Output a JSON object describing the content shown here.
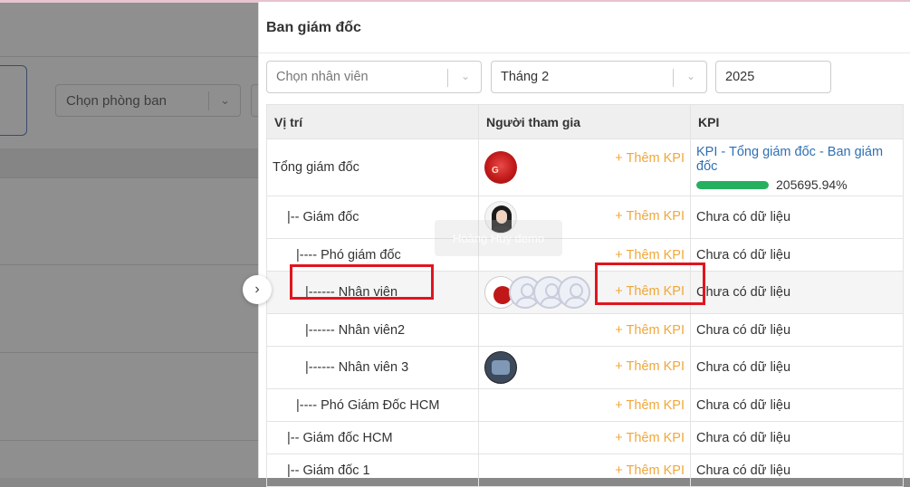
{
  "background": {
    "department_select_placeholder": "Chọn phòng ban"
  },
  "drawer": {
    "title": "Ban giám đốc",
    "filters": {
      "employee_placeholder": "Chọn nhân viên",
      "month_value": "Tháng 2",
      "year_value": "2025"
    },
    "table": {
      "headers": [
        "Vị trí",
        "Người tham gia",
        "KPI"
      ],
      "add_kpi_label": "+ Thêm KPI",
      "no_data_label": "Chưa có dữ liệu",
      "rows": [
        {
          "position": "Tổng giám đốc",
          "indent": 0,
          "avatars": [
            "red-avatar"
          ],
          "kpi_link": "KPI - Tổng giám đốc - Ban giám đốc",
          "progress": 1.0,
          "progress_text": "205695.94%"
        },
        {
          "position": "|-- Giám đốc",
          "indent": 1,
          "avatars": [
            "woman-avatar"
          ]
        },
        {
          "position": "|---- Phó giám đốc",
          "indent": 2,
          "avatars": []
        },
        {
          "position": "|------ Nhân viên",
          "indent": 3,
          "avatars": [
            "flower-avatar",
            "placeholder-avatar",
            "placeholder-avatar",
            "placeholder-avatar"
          ]
        },
        {
          "position": "|------ Nhân viên2",
          "indent": 3,
          "avatars": []
        },
        {
          "position": "|------ Nhân viên 3",
          "indent": 3,
          "avatars": [
            "game-avatar"
          ]
        },
        {
          "position": "|---- Phó Giám Đốc HCM",
          "indent": 2,
          "avatars": []
        },
        {
          "position": "|-- Giám đốc HCM",
          "indent": 1,
          "avatars": []
        },
        {
          "position": "|-- Giám đốc 1",
          "indent": 1,
          "avatars": []
        }
      ]
    },
    "watermark_text": "Hoàng Huy demo"
  },
  "colors": {
    "accent_orange": "#f0a73a",
    "link_blue": "#2f6fb3",
    "progress_green": "#25b060",
    "highlight_red": "#e0151e"
  }
}
